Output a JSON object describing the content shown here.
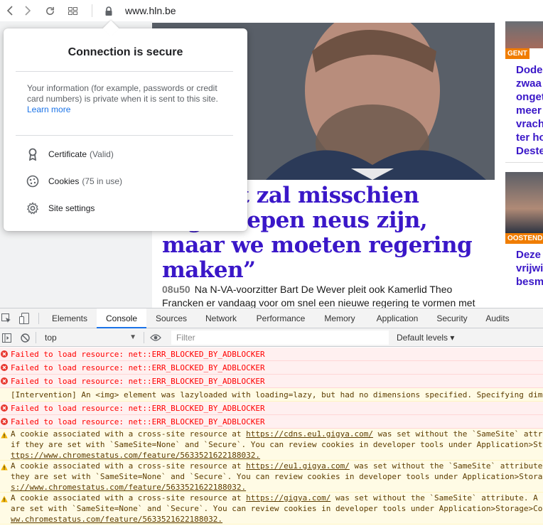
{
  "browser": {
    "url": "www.hln.be",
    "icons": [
      "back-icon",
      "forward-icon",
      "reload-icon",
      "apps-icon",
      "lock-icon"
    ]
  },
  "popup": {
    "title": "Connection is secure",
    "info_text": "Your information (for example, passwords or credit card numbers) is private when it is sent to this site.",
    "learn_more": "Learn more",
    "rows": [
      {
        "label": "Certificate",
        "sub": "(Valid)",
        "icon": "certificate-icon"
      },
      {
        "label": "Cookies",
        "sub": "(75 in use)",
        "icon": "cookie-icon"
      },
      {
        "label": "Site settings",
        "sub": "",
        "icon": "gear-icon"
      }
    ]
  },
  "article": {
    "headline_line1": "n: “Het zal misschien",
    "headline_line2": "ntgeknepen neus zijn,",
    "headline_line3": "maar we moeten regering",
    "headline_line4": "maken”",
    "time": "08u50",
    "lead_line1": "Na N-VA-voorzitter Bart De Wever pleit ook Kamerlid Theo",
    "lead_line2": "Francken er vandaag voor om snel een nieuwe regering te vormen met"
  },
  "sidebar": {
    "story1": {
      "tag": "GENT",
      "lines": [
        "Dode",
        "zwaa",
        "onget",
        "meer",
        "vrach",
        "ter ho",
        "Deste"
      ]
    },
    "story2": {
      "tag": "OOSTENDE",
      "lines": [
        "Deze",
        "vrijwi",
        "besm"
      ]
    }
  },
  "devtools": {
    "tabs": [
      "Elements",
      "Console",
      "Sources",
      "Network",
      "Performance",
      "Memory",
      "Application",
      "Security",
      "Audits"
    ],
    "active_tab": "Console",
    "context": "top",
    "filter_placeholder": "Filter",
    "levels": "Default levels ▾",
    "messages": [
      {
        "type": "error",
        "text": "Failed to load resource: net::ERR_BLOCKED_BY_ADBLOCKER"
      },
      {
        "type": "error",
        "text": "Failed to load resource: net::ERR_BLOCKED_BY_ADBLOCKER"
      },
      {
        "type": "error",
        "text": "Failed to load resource: net::ERR_BLOCKED_BY_ADBLOCKER"
      },
      {
        "type": "info",
        "text": "[Intervention] An <img> element was lazyloaded with loading=lazy, but had no dimensions specified. Specifying dim"
      },
      {
        "type": "error",
        "text": "Failed to load resource: net::ERR_BLOCKED_BY_ADBLOCKER"
      },
      {
        "type": "error",
        "text": "Failed to load resource: net::ERR_BLOCKED_BY_ADBLOCKER"
      },
      {
        "type": "warn",
        "pre": "A cookie associated with a cross-site resource at ",
        "link": "https://cdns.eu1.gigya.com/",
        "post": " was set without the `SameSite` attr",
        "line2": "if they are set with `SameSite=None` and `Secure`. You can review cookies in developer tools under Application>St",
        "line3": "ttps://www.chromestatus.com/feature/5633521622188032."
      },
      {
        "type": "warn",
        "pre": "A cookie associated with a cross-site resource at ",
        "link": "https://eu1.gigya.com/",
        "post": " was set without the `SameSite` attribute",
        "line2": "they are set with `SameSite=None` and `Secure`. You can review cookies in developer tools under Application>Stora",
        "line3": "s://www.chromestatus.com/feature/5633521622188032."
      },
      {
        "type": "warn",
        "pre": "A cookie associated with a cross-site resource at ",
        "link": "https://gigya.com/",
        "post": " was set without the `SameSite` attribute. A",
        "line2": "are set with `SameSite=None` and `Secure`. You can review cookies in developer tools under Application>Storage>Co",
        "line3": "ww.chromestatus.com/feature/5633521622188032."
      }
    ]
  },
  "colors": {
    "headline": "#3a17c8",
    "tag": "#f07d00",
    "error_text": "#ff0000",
    "warn_text": "#5c3c00",
    "link": "#1a73e8"
  }
}
